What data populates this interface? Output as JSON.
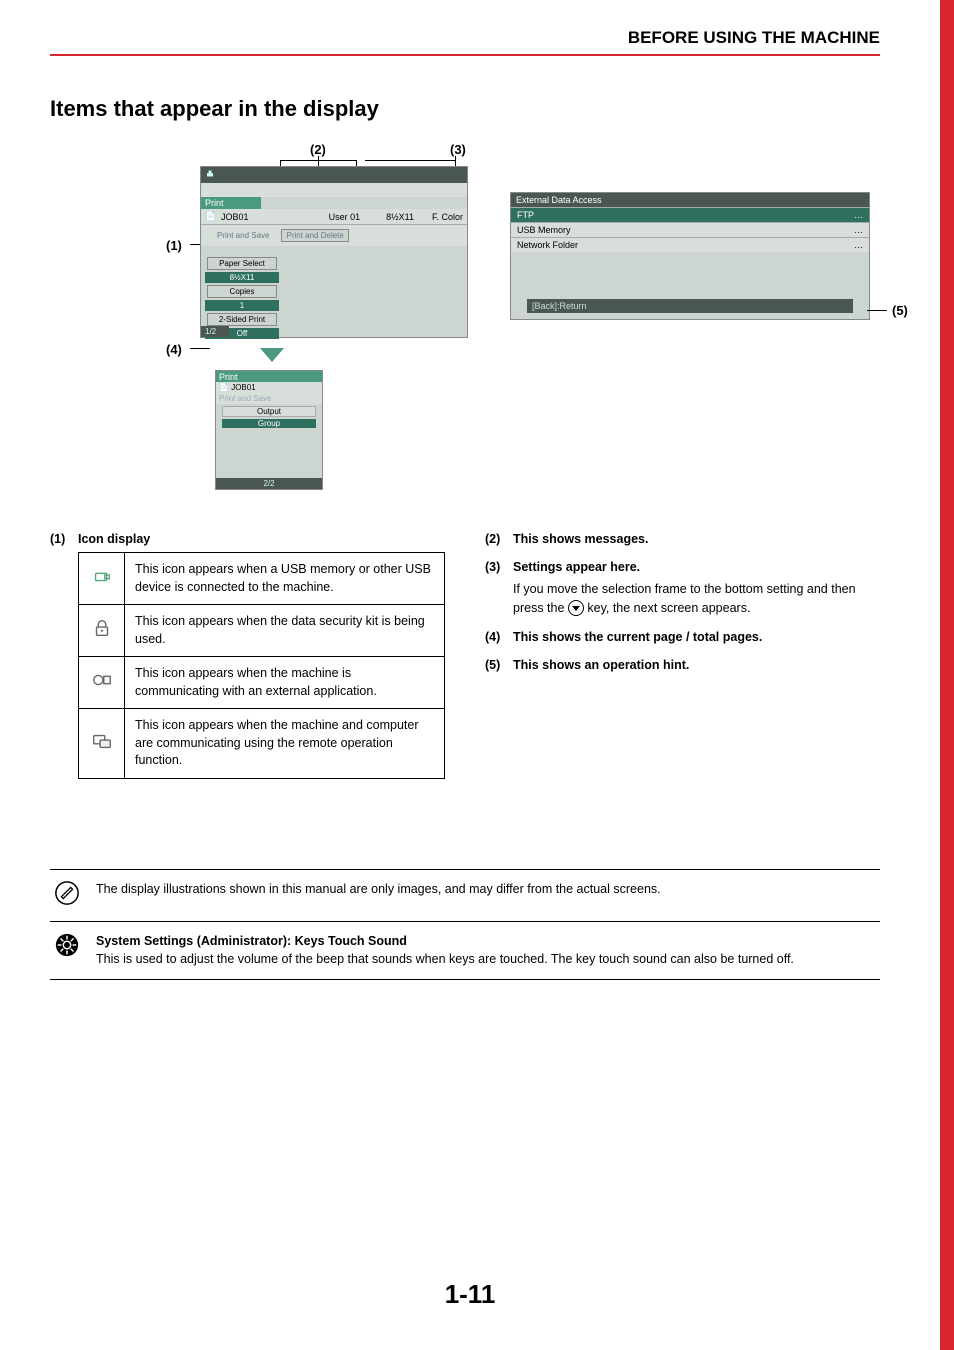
{
  "header": "BEFORE USING THE MACHINE",
  "section_title": "Items that appear in the display",
  "callouts": {
    "c1": "(1)",
    "c2": "(2)",
    "c3": "(3)",
    "c4": "(4)",
    "c5": "(5)"
  },
  "lcd1": {
    "print": "Print",
    "job": "JOB01",
    "user": "User 01",
    "size": "8½X11",
    "color": "F. Color",
    "subrow": "Print and Save",
    "btn_pd": "Print and Delete",
    "paper_select": "Paper Select",
    "paper_val": "8½X11",
    "copies": "Copies",
    "copies_val": "1",
    "twosided": "2-Sided Print",
    "twosided_val": "Off",
    "pager": "1/2"
  },
  "lcd2": {
    "print": "Print",
    "job": "JOB01",
    "subrow": "Print and Save",
    "output": "Output",
    "group": "Group",
    "pager": "2/2"
  },
  "lcd3": {
    "title": "External Data Access",
    "rows": [
      "FTP",
      "USB Memory",
      "Network Folder"
    ],
    "ell": "…",
    "hint": "[Back]:Return"
  },
  "left_list": {
    "head_num": "(1)",
    "head": "Icon display",
    "rows": [
      "This icon appears when a USB memory or other USB device is connected to the machine.",
      "This icon appears when the data security kit is being used.",
      "This icon appears when the machine is communicating with an external application.",
      "This icon appears when the machine and computer are communicating using the remote operation function."
    ]
  },
  "right_list": {
    "i2_num": "(2)",
    "i2": "This shows messages.",
    "i3_num": "(3)",
    "i3": "Settings appear here.",
    "i3_body_a": "If you move the selection frame to the bottom setting and then press the ",
    "i3_body_b": " key, the next screen appears.",
    "i4_num": "(4)",
    "i4": "This shows the current page / total pages.",
    "i5_num": "(5)",
    "i5": "This shows an operation hint."
  },
  "footnotes": {
    "note1": "The display illustrations shown in this manual are only images, and may differ from the actual screens.",
    "note2_title": "System Settings (Administrator): Keys Touch Sound",
    "note2_body": "This is used to adjust the volume of the beep that sounds when keys are touched. The key touch sound can also be turned off."
  },
  "page_number": "1-11"
}
